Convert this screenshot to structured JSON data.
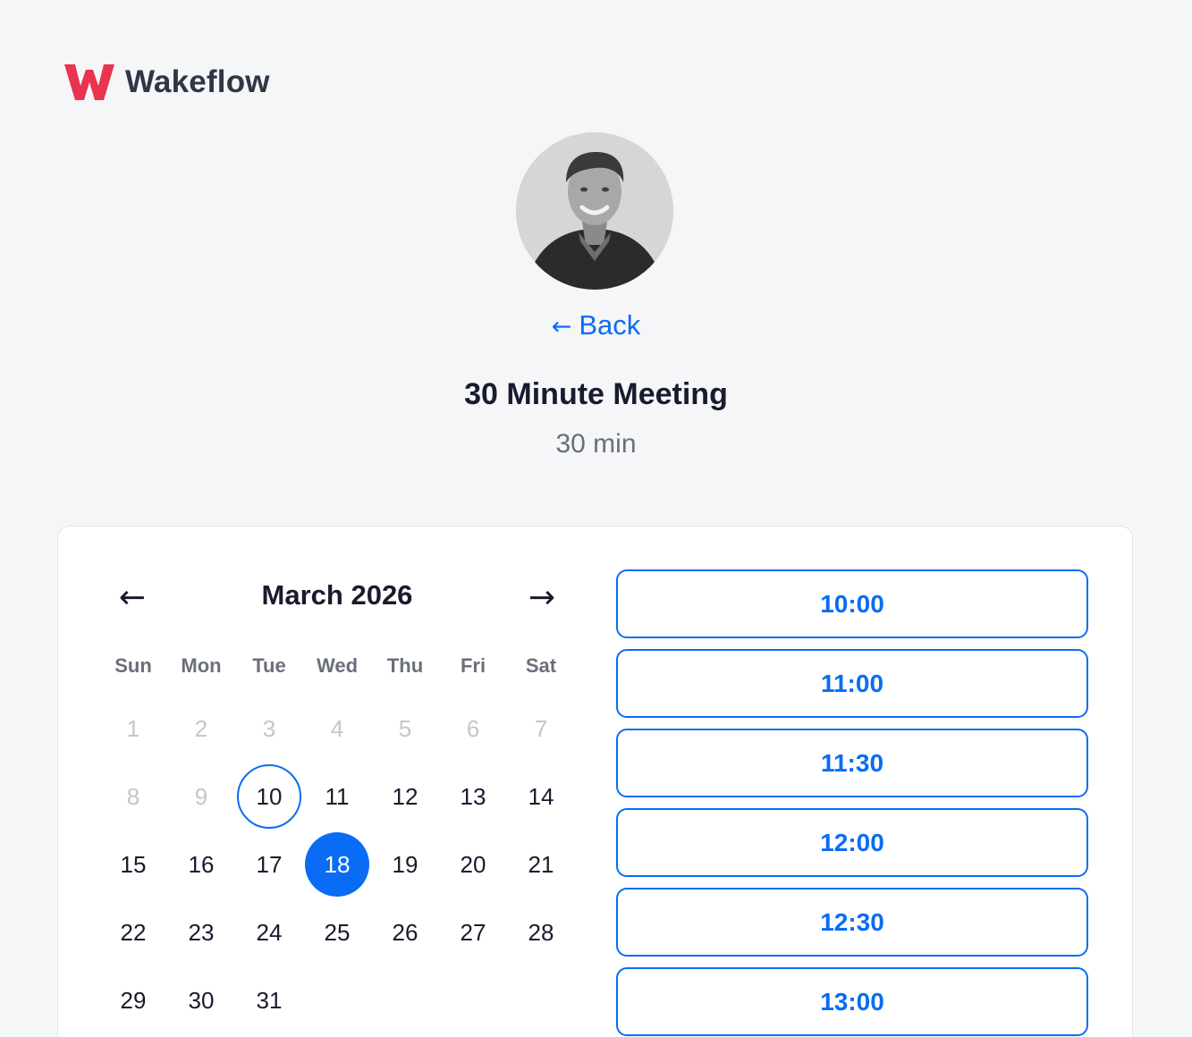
{
  "brand": {
    "name": "Wakeflow",
    "mark_color": "#e8344e"
  },
  "host": {
    "avatar": "host-photo"
  },
  "nav": {
    "back_label": "Back",
    "back_icon": "arrow-left-icon"
  },
  "event": {
    "title": "30 Minute Meeting",
    "duration": "30 min"
  },
  "calendar": {
    "month_label": "March 2026",
    "prev_icon": "←",
    "next_icon": "→",
    "weekdays": [
      "Sun",
      "Mon",
      "Tue",
      "Wed",
      "Thu",
      "Fri",
      "Sat"
    ],
    "leading_blanks": 0,
    "days": [
      {
        "label": "1",
        "state": "disabled"
      },
      {
        "label": "2",
        "state": "disabled"
      },
      {
        "label": "3",
        "state": "disabled"
      },
      {
        "label": "4",
        "state": "disabled"
      },
      {
        "label": "5",
        "state": "disabled"
      },
      {
        "label": "6",
        "state": "disabled"
      },
      {
        "label": "7",
        "state": "disabled"
      },
      {
        "label": "8",
        "state": "disabled"
      },
      {
        "label": "9",
        "state": "disabled"
      },
      {
        "label": "10",
        "state": "today"
      },
      {
        "label": "11",
        "state": "available"
      },
      {
        "label": "12",
        "state": "available"
      },
      {
        "label": "13",
        "state": "available"
      },
      {
        "label": "14",
        "state": "available"
      },
      {
        "label": "15",
        "state": "available"
      },
      {
        "label": "16",
        "state": "available"
      },
      {
        "label": "17",
        "state": "available"
      },
      {
        "label": "18",
        "state": "selected"
      },
      {
        "label": "19",
        "state": "available"
      },
      {
        "label": "20",
        "state": "available"
      },
      {
        "label": "21",
        "state": "available"
      },
      {
        "label": "22",
        "state": "available"
      },
      {
        "label": "23",
        "state": "available"
      },
      {
        "label": "24",
        "state": "available"
      },
      {
        "label": "25",
        "state": "available"
      },
      {
        "label": "26",
        "state": "available"
      },
      {
        "label": "27",
        "state": "available"
      },
      {
        "label": "28",
        "state": "available"
      },
      {
        "label": "29",
        "state": "available"
      },
      {
        "label": "30",
        "state": "available"
      },
      {
        "label": "31",
        "state": "available"
      }
    ]
  },
  "time_slots": [
    "10:00",
    "11:00",
    "11:30",
    "12:00",
    "12:30",
    "13:00"
  ],
  "colors": {
    "accent": "#0a6cf5",
    "background": "#f5f6f8",
    "text": "#1a1a2e",
    "muted": "#6b6f7b",
    "disabled": "#c4c6cc"
  }
}
